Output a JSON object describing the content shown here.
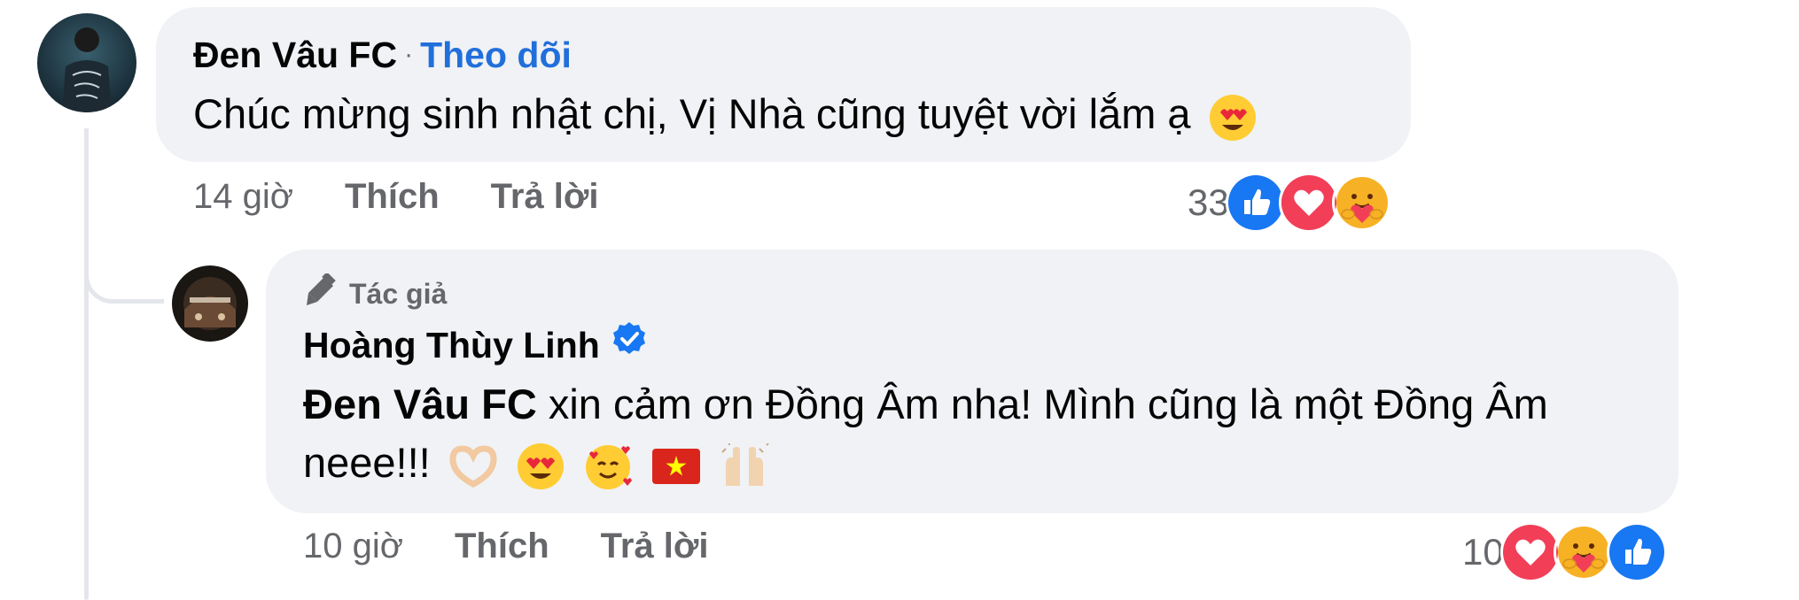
{
  "comments": [
    {
      "author": "Đen Vâu FC",
      "separator": "·",
      "follow_label": "Theo dõi",
      "text": "Chúc mừng sinh nhật chị, Vị Nhà cũng tuyệt vời lắm ạ",
      "emojis": [
        "heart-eyes-emoji"
      ],
      "time": "14 giờ",
      "like_label": "Thích",
      "reply_label": "Trả lời",
      "reaction_count": "33",
      "reactions": [
        "like-icon",
        "love-icon",
        "care-icon"
      ]
    },
    {
      "badge": "Tác giả",
      "author": "Hoàng Thùy Linh",
      "verified": true,
      "mention": "Đen Vâu FC",
      "text": " xin cảm ơn Đồng Âm nha! Mình cũng là một Đồng Âm neee!!!",
      "emojis": [
        "heart-hands-emoji",
        "heart-eyes-emoji",
        "smiling-hearts-emoji",
        "vietnam-flag-emoji",
        "raising-hands-emoji"
      ],
      "time": "10 giờ",
      "like_label": "Thích",
      "reply_label": "Trả lời",
      "reaction_count": "10",
      "reactions": [
        "love-icon",
        "care-icon",
        "like-icon"
      ]
    }
  ],
  "colors": {
    "bubble": "#f0f2f5",
    "follow": "#216fdb",
    "secondary_text": "#65676b",
    "like": "#1877f2",
    "love": "#f33e58",
    "care": "#f7b125"
  }
}
